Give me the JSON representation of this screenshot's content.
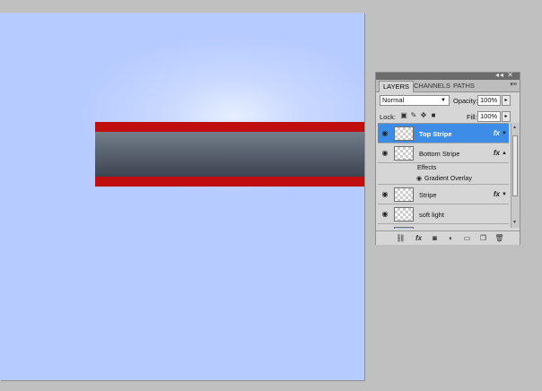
{
  "panel": {
    "tabs": [
      "LAYERS",
      "CHANNELS",
      "PATHS"
    ],
    "blend_mode": "Normal",
    "opacity_label": "Opacity:",
    "opacity_value": "100%",
    "lock_label": "Lock:",
    "fill_label": "Fill:",
    "fill_value": "100%",
    "layers": [
      {
        "name": "Top Stripe",
        "selected": true,
        "fx": "fx"
      },
      {
        "name": "Bottom Stripe",
        "fx": "fx",
        "effects_label": "Effects",
        "effect": "Gradient Overlay"
      },
      {
        "name": "Stripe",
        "fx": "fx"
      },
      {
        "name": "soft light"
      }
    ]
  },
  "colors": {
    "stripe_red": "#c00d0d",
    "canvas_blue": "#b6cbff",
    "selection_blue": "#3d8de6"
  }
}
